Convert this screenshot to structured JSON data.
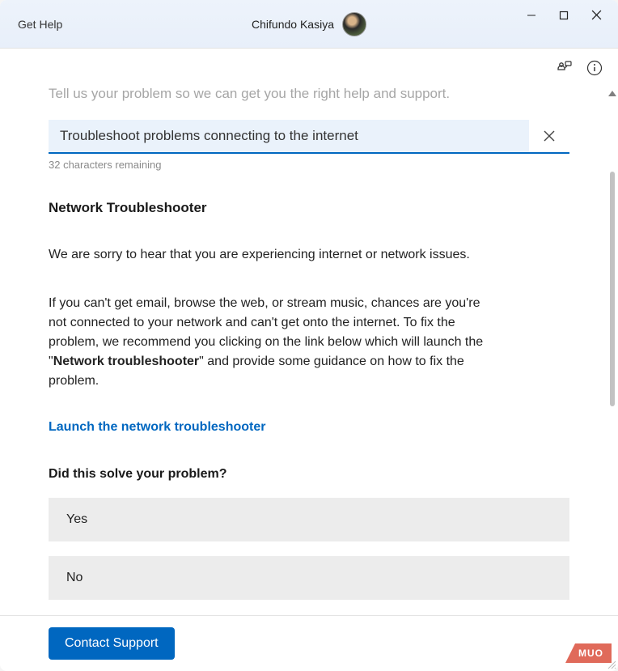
{
  "window": {
    "app_title": "Get Help",
    "user_name": "Chifundo Kasiya"
  },
  "content": {
    "prompt": "Tell us your problem so we can get you the right help and support.",
    "search_value": "Troubleshoot problems connecting to the internet",
    "char_remaining": "32 characters remaining",
    "section_title": "Network Troubleshooter",
    "para1": "We are sorry to hear that you are experiencing internet or network issues.",
    "para2_a": "If you can't get email, browse the web, or stream music, chances are you're not connected to your network and can't get onto the internet. To fix the problem, we recommend you clicking on the link below which will launch the \"",
    "para2_bold": "Network troubleshooter",
    "para2_b": "\" and provide some guidance on how to fix the problem.",
    "launch_link": "Launch the network troubleshooter",
    "question": "Did this solve your problem?",
    "answer_yes": "Yes",
    "answer_no": "No"
  },
  "footer": {
    "contact": "Contact Support"
  },
  "watermark": "MUO"
}
